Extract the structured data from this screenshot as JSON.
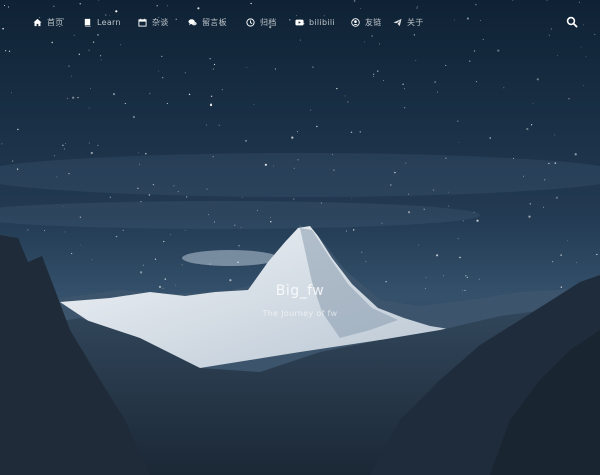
{
  "nav": {
    "items": [
      {
        "label": "首页",
        "icon": "home-icon"
      },
      {
        "label": "Learn",
        "icon": "book-icon"
      },
      {
        "label": "杂谈",
        "icon": "calendar-icon"
      },
      {
        "label": "留言板",
        "icon": "comments-icon"
      },
      {
        "label": "归档",
        "icon": "clock-icon"
      },
      {
        "label": "bilibili",
        "icon": "play-icon"
      },
      {
        "label": "友链",
        "icon": "user-circle-icon"
      },
      {
        "label": "关于",
        "icon": "paper-plane-icon"
      }
    ],
    "search_icon": "search-icon"
  },
  "hero": {
    "title": "Big_fw",
    "subtitle": "The Journey of fw"
  },
  "colors": {
    "sky_top": "#10263a",
    "sky_bottom": "#2e4964",
    "snow": "#e9eef3",
    "mountain_dark": "#1c2a3a"
  }
}
